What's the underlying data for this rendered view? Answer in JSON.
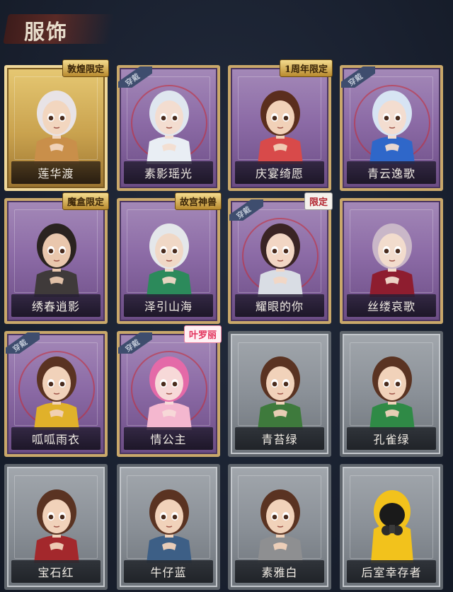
{
  "header": {
    "title": "服饰"
  },
  "cards": [
    {
      "name": "莲华渡",
      "style": "gold",
      "wearing": false,
      "badge": "敦煌限定",
      "badge_style": "gold",
      "skin": "#f2d6bf",
      "hair": "#e8e3e6",
      "cloth": "#c98f4a",
      "icon": "character-portrait-icon"
    },
    {
      "name": "素影瑶光",
      "style": "purple",
      "wearing": true,
      "badge": "",
      "badge_style": "",
      "skin": "#f3ddd0",
      "hair": "#dfe6ef",
      "cloth": "#e9eef4",
      "icon": "character-portrait-icon"
    },
    {
      "name": "庆宴绮愿",
      "style": "purple",
      "wearing": false,
      "badge": "1周年限定",
      "badge_style": "gold",
      "skin": "#f1d1b8",
      "hair": "#5b2e1e",
      "cloth": "#d84a4a",
      "icon": "character-portrait-icon"
    },
    {
      "name": "青云逸歌",
      "style": "purple",
      "wearing": true,
      "badge": "",
      "badge_style": "",
      "skin": "#f3ddd0",
      "hair": "#d7e4f3",
      "cloth": "#2f67c9",
      "icon": "character-portrait-icon"
    },
    {
      "name": "绣春逍影",
      "style": "purple",
      "wearing": false,
      "badge": "魔盒限定",
      "badge_style": "gold",
      "skin": "#e9c7ad",
      "hair": "#2a2320",
      "cloth": "#3f3a3a",
      "icon": "character-portrait-icon"
    },
    {
      "name": "泽引山海",
      "style": "purple",
      "wearing": false,
      "badge": "故宫神兽",
      "badge_style": "gold",
      "skin": "#f0d8c6",
      "hair": "#e4e7ea",
      "cloth": "#2c8a5b",
      "icon": "character-portrait-icon"
    },
    {
      "name": "耀眼的你",
      "style": "purple",
      "wearing": true,
      "badge": "限定",
      "badge_style": "white",
      "skin": "#f2d6c4",
      "hair": "#3a2424",
      "cloth": "#d9dde4",
      "icon": "character-portrait-icon"
    },
    {
      "name": "丝缕哀歌",
      "style": "purple",
      "wearing": false,
      "badge": "",
      "badge_style": "",
      "skin": "#f2dccd",
      "hair": "#c9b7c8",
      "cloth": "#8e1d2f",
      "icon": "character-portrait-icon"
    },
    {
      "name": "呱呱雨衣",
      "style": "purple",
      "wearing": true,
      "badge": "",
      "badge_style": "",
      "skin": "#f1d2ba",
      "hair": "#5a3322",
      "cloth": "#e0b12a",
      "icon": "character-portrait-icon"
    },
    {
      "name": "情公主",
      "style": "purple",
      "wearing": true,
      "badge": "叶罗丽",
      "badge_style": "pink",
      "skin": "#f7d9d8",
      "hair": "#e46aa8",
      "cloth": "#f4b7cf",
      "icon": "character-portrait-icon"
    },
    {
      "name": "青苔绿",
      "style": "grey",
      "wearing": false,
      "badge": "",
      "badge_style": "",
      "skin": "#f1d2ba",
      "hair": "#5a3322",
      "cloth": "#3e7a3c",
      "icon": "character-portrait-icon"
    },
    {
      "name": "孔雀绿",
      "style": "grey",
      "wearing": false,
      "badge": "",
      "badge_style": "",
      "skin": "#f1d2ba",
      "hair": "#5a3322",
      "cloth": "#2f8a46",
      "icon": "character-portrait-icon"
    },
    {
      "name": "宝石红",
      "style": "grey",
      "wearing": false,
      "badge": "",
      "badge_style": "",
      "skin": "#f1d2ba",
      "hair": "#5a3322",
      "cloth": "#a3282c",
      "icon": "character-portrait-icon"
    },
    {
      "name": "牛仔蓝",
      "style": "grey",
      "wearing": false,
      "badge": "",
      "badge_style": "",
      "skin": "#f1d2ba",
      "hair": "#5a3322",
      "cloth": "#3d5f86",
      "icon": "character-portrait-icon"
    },
    {
      "name": "素雅白",
      "style": "grey",
      "wearing": false,
      "badge": "",
      "badge_style": "",
      "skin": "#f1d2ba",
      "hair": "#5a3322",
      "cloth": "#8e8f91",
      "icon": "character-portrait-icon"
    },
    {
      "name": "后室幸存者",
      "style": "grey",
      "wearing": false,
      "badge": "",
      "badge_style": "",
      "skin": "#1a1a1a",
      "hair": "#f2c21c",
      "cloth": "#f2c21c",
      "icon": "hazmat-suit-portrait-icon"
    }
  ],
  "wear_label": "穿戴"
}
